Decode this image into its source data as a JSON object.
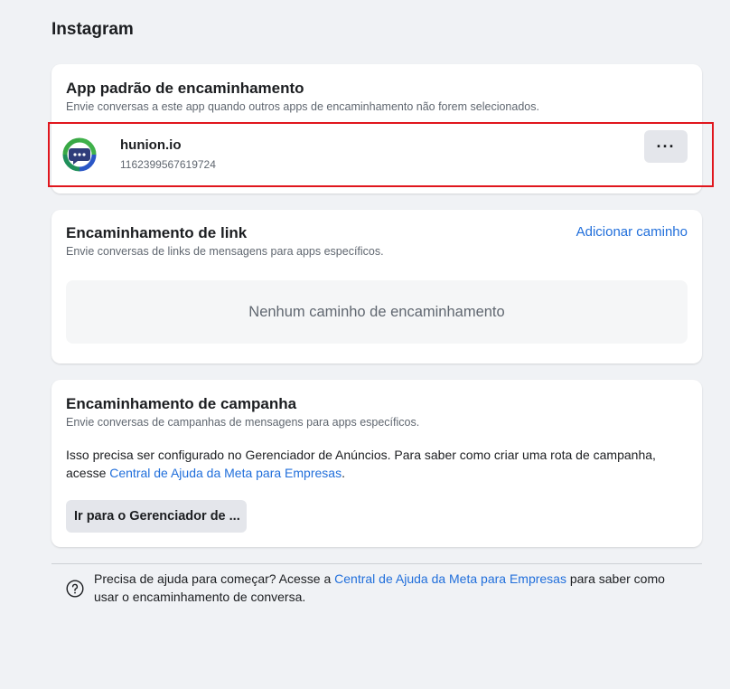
{
  "page": {
    "title": "Instagram"
  },
  "default_app": {
    "title": "App padrão de encaminhamento",
    "subtitle": "Envie conversas a este app quando outros apps de encaminhamento não forem selecionados.",
    "app": {
      "name": "hunion.io",
      "id": "1162399567619724",
      "more_label": "···"
    },
    "colors": {
      "highlight": "#e0161d"
    }
  },
  "link_routing": {
    "title": "Encaminhamento de link",
    "subtitle": "Envie conversas de links de mensagens para apps específicos.",
    "add_label": "Adicionar caminho",
    "empty_text": "Nenhum caminho de encaminhamento"
  },
  "campaign_routing": {
    "title": "Encaminhamento de campanha",
    "subtitle": "Envie conversas de campanhas de mensagens para apps específicos.",
    "body_prefix": "Isso precisa ser configurado no Gerenciador de Anúncios. Para saber como criar uma rota de campanha, acesse ",
    "body_link": "Central de Ajuda da Meta para Empresas",
    "body_suffix": ".",
    "button_label": "Ir para o Gerenciador de ..."
  },
  "help": {
    "prefix": "Precisa de ajuda para começar? Acesse a ",
    "link": "Central de Ajuda da Meta para Empresas",
    "suffix": " para saber como usar o encaminhamento de conversa."
  }
}
